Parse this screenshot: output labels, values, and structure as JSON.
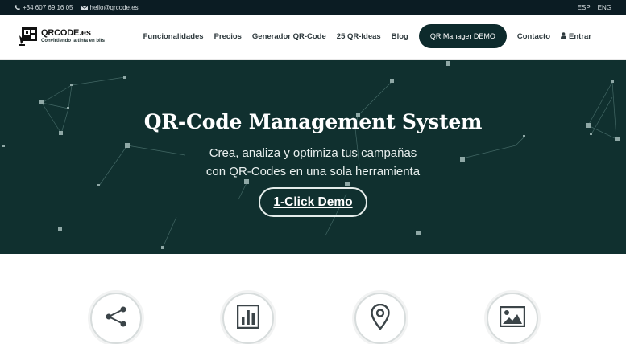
{
  "topbar": {
    "phone": "+34 607 69 16 05",
    "email": "hello@qrcode.es",
    "lang_es": "ESP",
    "lang_en": "ENG"
  },
  "brand": {
    "name": "QRCODE.es",
    "tagline": "Convirtiendo la tinta en bits"
  },
  "nav": {
    "items": [
      "Funcionalidades",
      "Precios",
      "Generador QR-Code",
      "25 QR-Ideas",
      "Blog"
    ],
    "cta": "QR Manager DEMO",
    "contact": "Contacto",
    "login": "Entrar"
  },
  "hero": {
    "title": "QR-Code Management System",
    "sub_line1": "Crea, analiza y optimiza tus campañas",
    "sub_line2": "con QR-Codes en una sola herramienta",
    "button": "1-Click Demo"
  },
  "features": {
    "icons": [
      "share-icon",
      "bar-chart-icon",
      "location-pin-icon",
      "image-icon"
    ]
  },
  "colors": {
    "topbar": "#0b1c23",
    "hero_bg": "#10302f",
    "cta_bg": "#0d2a2c",
    "circle_border": "#d7dcdc"
  }
}
